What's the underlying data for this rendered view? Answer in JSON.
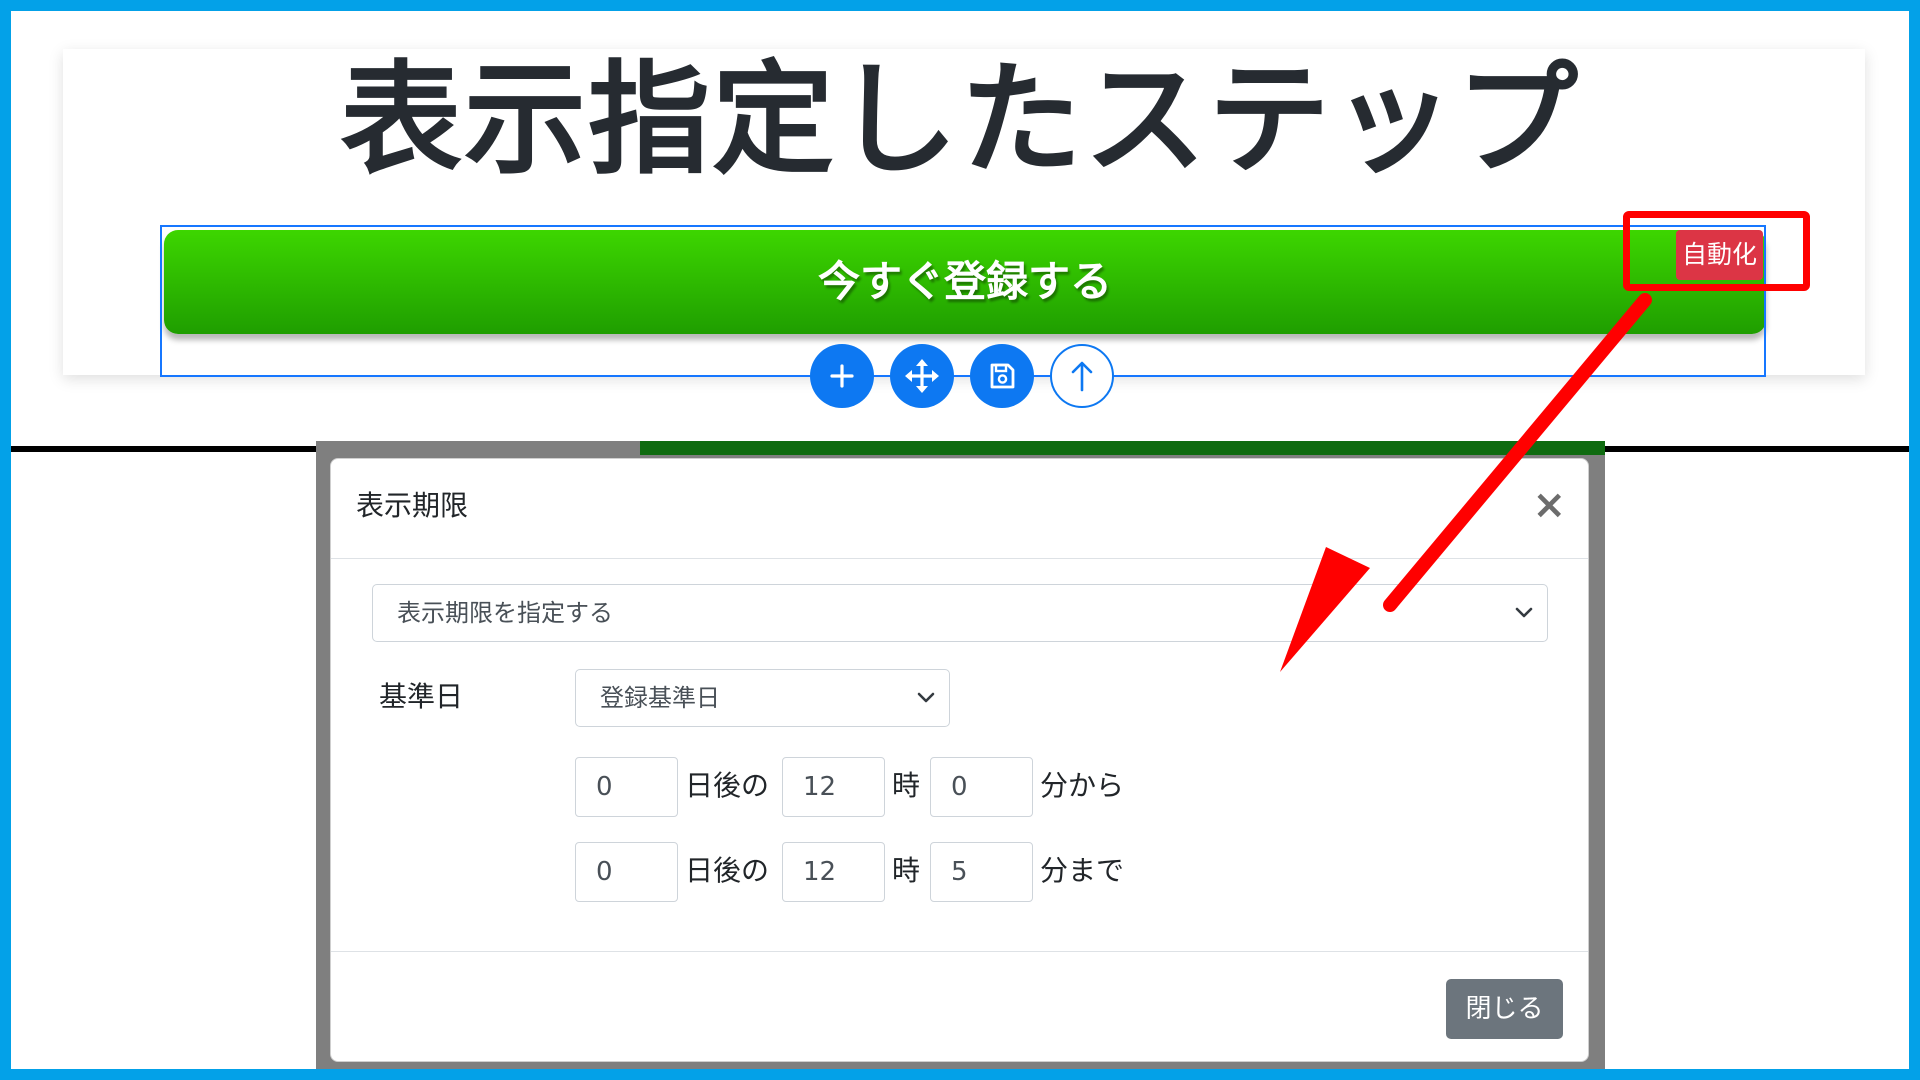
{
  "top": {
    "headline": "表示指定したステップ",
    "cta_label": "今すぐ登録する",
    "auto_badge": "自動化",
    "toolbar": {
      "add_icon": "plus-icon",
      "move_icon": "move-arrows-icon",
      "save_icon": "floppy-disk-icon",
      "up_icon": "arrow-up-icon"
    }
  },
  "modal": {
    "title": "表示期限",
    "close_symbol": "×",
    "mode_select": "表示期限を指定する",
    "base_date_label": "基準日",
    "base_date_select": "登録基準日",
    "from_row": {
      "days": "0",
      "days_suffix": "日後の",
      "hour": "12",
      "hour_suffix": "時",
      "minute": "0",
      "minute_suffix": "分から"
    },
    "to_row": {
      "days": "0",
      "days_suffix": "日後の",
      "hour": "12",
      "hour_suffix": "時",
      "minute": "5",
      "minute_suffix": "分まで"
    },
    "close_button": "閉じる"
  },
  "colors": {
    "frame": "#03a1e8",
    "cta_green": "#2fbf00",
    "badge_red": "#dc3545",
    "highlight_red": "#ff0000",
    "tool_blue": "#0d78f2",
    "close_gray": "#6c757d"
  }
}
